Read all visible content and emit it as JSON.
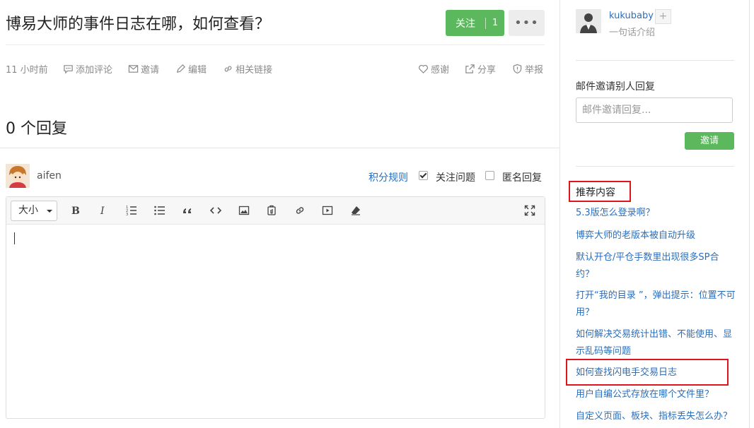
{
  "question": {
    "title": "博易大师的事件日志在哪，如何查看？",
    "follow_label": "关注",
    "follow_count": "1",
    "more_label": "•••"
  },
  "meta": {
    "time": "11 小时前",
    "comment": "添加评论",
    "invite": "邀请",
    "edit": "编辑",
    "related": "相关链接",
    "thanks": "感谢",
    "share": "分享",
    "report": "举报"
  },
  "answers": {
    "count_label": "0 个回复"
  },
  "composer": {
    "username": "aifen",
    "rules_link": "积分规则",
    "follow_question": "关注问题",
    "follow_checked": true,
    "anonymous": "匿名回复",
    "anonymous_checked": false,
    "size_label": "大小"
  },
  "sidebar": {
    "user": {
      "name": "kukubaby",
      "intro": "一句话介绍",
      "plus": "+"
    },
    "invite": {
      "title": "邮件邀请别人回复",
      "placeholder": "邮件邀请回复...",
      "button": "邀请"
    },
    "recommend": {
      "title": "推荐内容",
      "items": [
        "5.3版怎么登录啊？",
        "博弈大师的老版本被自动升级",
        "默认开仓/平仓手数里出现很多SP合约？",
        "打开“我的目录 ”，弹出提示：位置不可用？",
        "如何解决交易统计出错、不能使用、显示乱码等问题",
        "如何查找闪电手交易日志",
        "用户自编公式存放在哪个文件里？",
        "自定义页面、板块、指标丢失怎么办？"
      ]
    }
  },
  "colors": {
    "accent_green": "#5cb85c",
    "link_blue": "#2a6ebb",
    "highlight_red": "#e0141e"
  }
}
